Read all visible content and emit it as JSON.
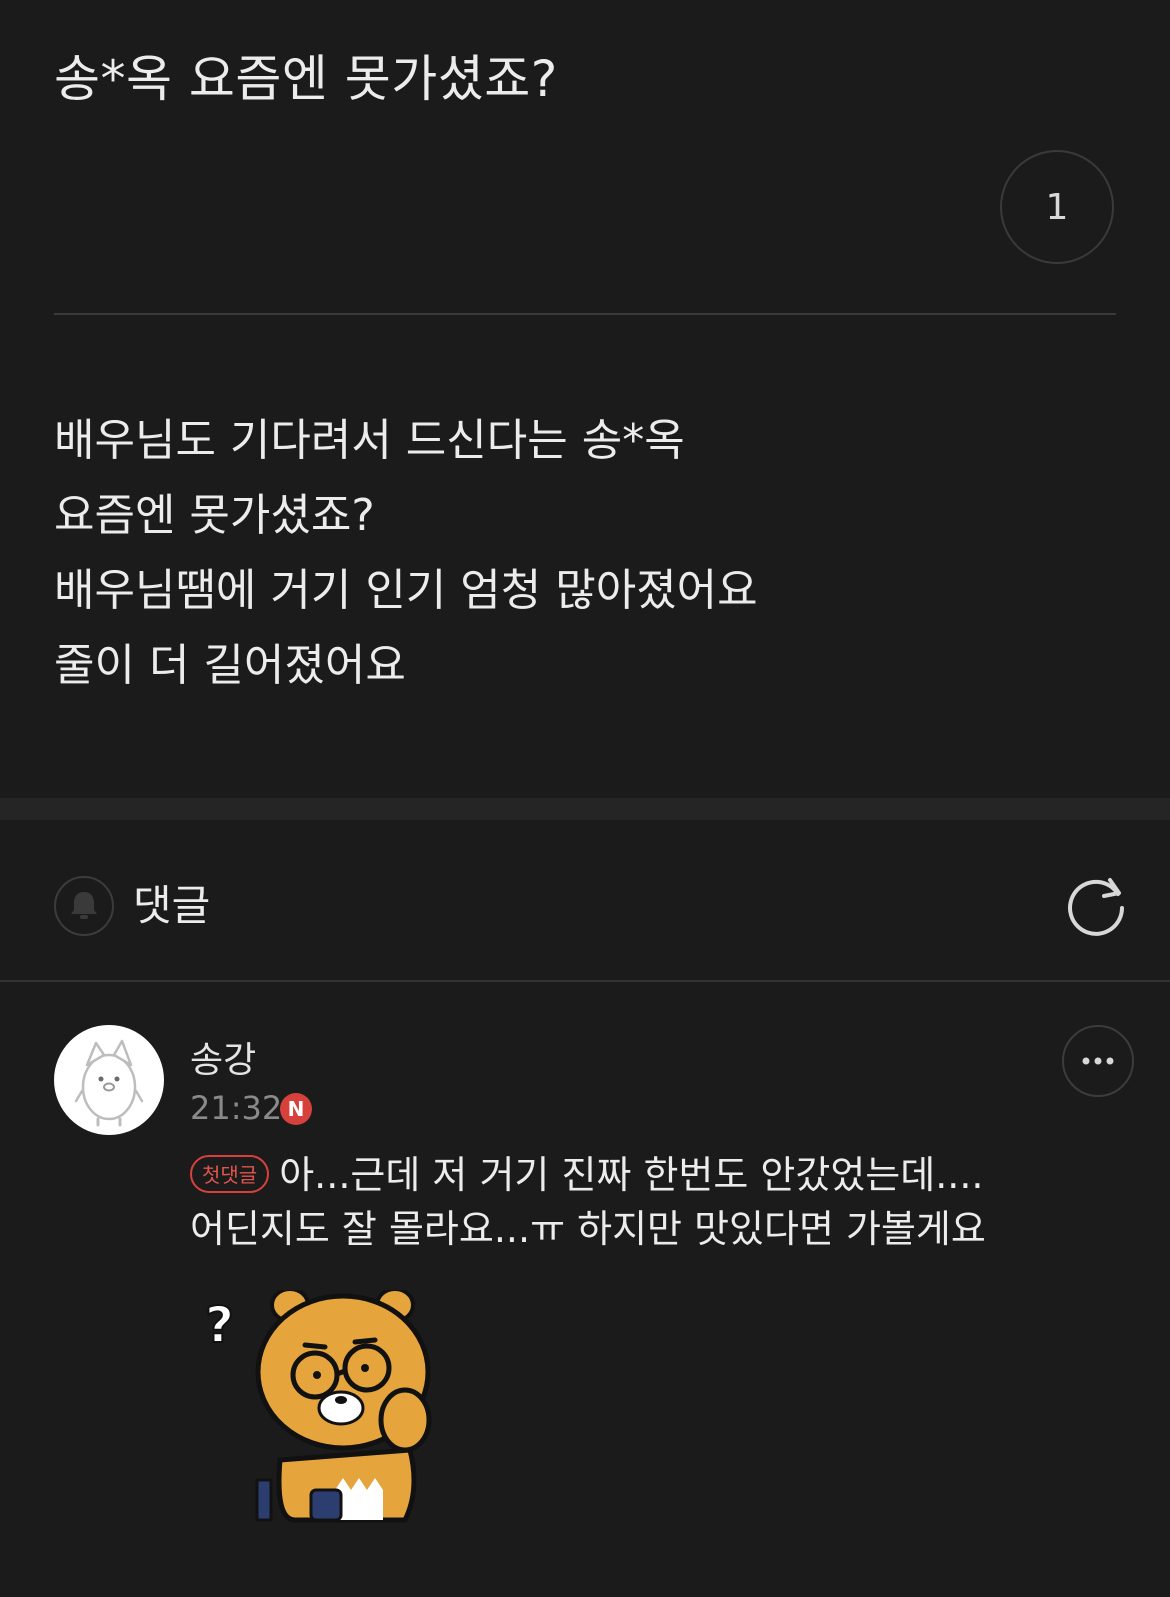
{
  "post": {
    "title": "송*옥 요즘엔 못가셨죠?",
    "like_count": "1",
    "body_lines": [
      "배우님도 기다려서 드신다는 송*옥",
      "요즘엔 못가셨죠?",
      "배우님땜에 거기 인기 엄청 많아졌어요",
      "줄이 더 길어졌어요"
    ]
  },
  "comments_section": {
    "label": "댓글",
    "icons": {
      "notify": "bell-icon",
      "refresh": "refresh-icon"
    }
  },
  "comment": {
    "author": "송강",
    "time": "21:32",
    "new_badge": "N",
    "first_badge": "첫댓글",
    "text_lines": [
      "아...근데 저 거기 진짜 한번도 안갔었는데....",
      "어딘지도 잘 몰라요...ㅠ 하지만 맛있다면 가볼게요"
    ],
    "avatar_icon": "penguin-avatar-icon",
    "sticker_icon": "bear-thinking-sticker",
    "more_icon": "more-dots-icon"
  },
  "colors": {
    "background": "#1b1b1c",
    "accent_red": "#d6423b",
    "text": "#ececec",
    "muted": "#8a8a8b"
  }
}
